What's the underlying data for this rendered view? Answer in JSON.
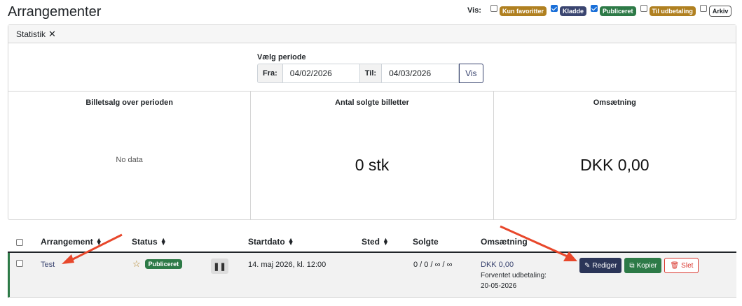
{
  "title": "Arrangementer",
  "filters": {
    "label": "Vis:",
    "items": [
      {
        "label": "Kun favoritter",
        "checked": false,
        "color": "#b08020"
      },
      {
        "label": "Kladde",
        "checked": true,
        "color": "#3a4570"
      },
      {
        "label": "Publiceret",
        "checked": true,
        "color": "#2d7a47"
      },
      {
        "label": "Til udbetaling",
        "checked": false,
        "color": "#b08020"
      },
      {
        "label": "Arkiv",
        "checked": false,
        "color": "#ffffff"
      }
    ]
  },
  "stats": {
    "header": "Statistik",
    "period_label": "Vælg periode",
    "from_label": "Fra:",
    "from_value": "04/02/2026",
    "to_label": "Til:",
    "to_value": "04/03/2026",
    "show_button": "Vis",
    "cards": [
      {
        "title": "Billetsalg over perioden",
        "value": "No data"
      },
      {
        "title": "Antal solgte billetter",
        "value": "0 stk"
      },
      {
        "title": "Omsætning",
        "value": "DKK 0,00"
      }
    ]
  },
  "table": {
    "headers": {
      "event": "Arrangement",
      "status": "Status",
      "start": "Startdato",
      "place": "Sted",
      "sold": "Solgte",
      "revenue": "Omsætning"
    },
    "rows": [
      {
        "name": "Test",
        "status": "Publiceret",
        "start": "14. maj 2026, kl. 12:00",
        "place": "",
        "sold": "0 / 0 / ∞ / ∞",
        "revenue": "DKK 0,00",
        "payout_label": "Forventet udbetaling:",
        "payout_date": "20-05-2026",
        "edit": "Rediger",
        "copy": "Kopier",
        "delete": "Slet"
      }
    ]
  },
  "colors": {
    "published": "#2d7a47",
    "primary": "#2b3558",
    "danger": "#d9352c",
    "annotation_arrow": "#e8472b"
  }
}
